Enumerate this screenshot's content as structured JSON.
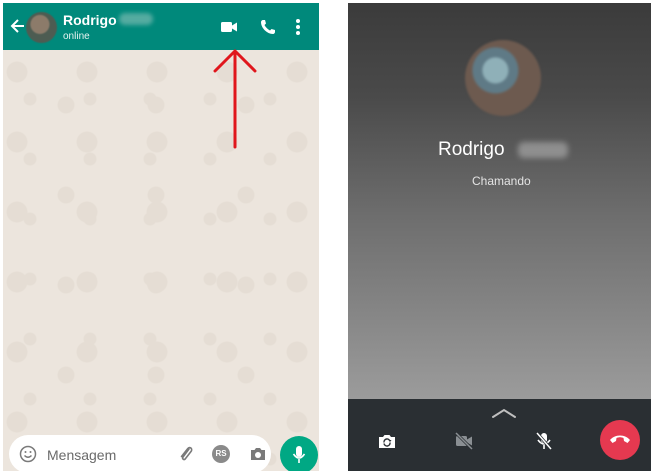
{
  "chat": {
    "contact_name": "Rodrigo",
    "status": "online",
    "input_placeholder": "Mensagem",
    "badge": "RS",
    "icons": [
      "back-arrow-icon",
      "video-call-icon",
      "voice-call-icon",
      "more-vert-icon",
      "emoji-icon",
      "attach-clip-icon",
      "camera-icon",
      "mic-icon"
    ],
    "colors": {
      "header": "#00897b",
      "mic_button": "#00a884",
      "annotation_arrow": "#e0161c"
    }
  },
  "call": {
    "contact_name": "Rodrigo",
    "status": "Chamando",
    "controls": [
      "flip-camera-icon",
      "video-off-icon",
      "mic-off-icon",
      "end-call-icon"
    ],
    "colors": {
      "end_call": "#e53950",
      "panel": "#2a2f33"
    }
  }
}
